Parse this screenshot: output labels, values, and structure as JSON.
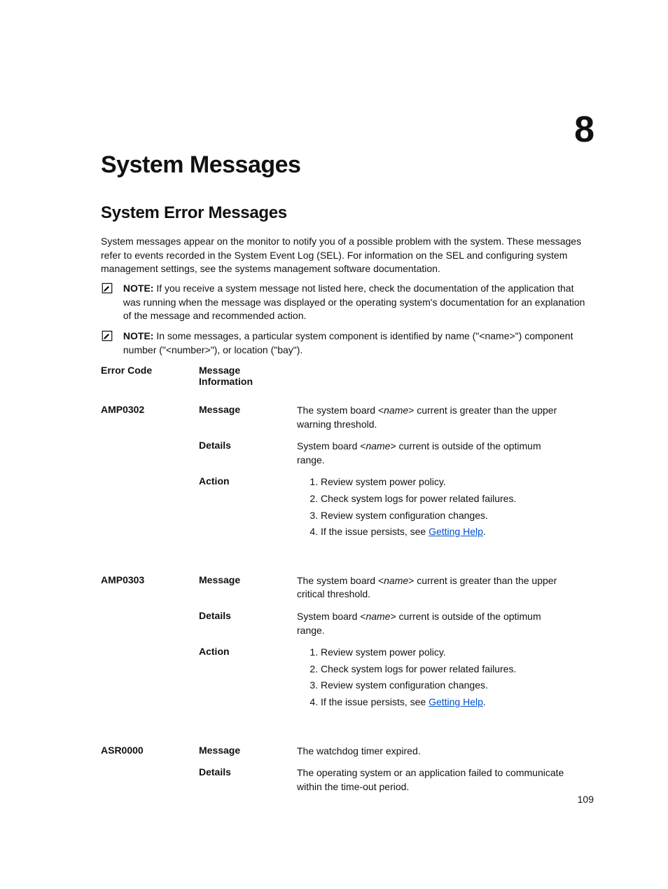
{
  "chapter_number": "8",
  "title": "System Messages",
  "subtitle": "System Error Messages",
  "intro": "System messages appear on the monitor to notify you of a possible problem with the system. These messages refer to events recorded in the System Event Log (SEL). For information on the SEL and configuring system management settings, see the systems management software documentation.",
  "notes": [
    {
      "label": "NOTE:",
      "text": " If you receive a system message not listed here, check the documentation of the application that was running when the message was displayed or the operating system's documentation for an explanation of the message and recommended action."
    },
    {
      "label": "NOTE:",
      "text": " In some messages, a particular system component is identified by name (\"<name>\") component number (\"<number>\"), or location (\"bay\")."
    }
  ],
  "table": {
    "headers": {
      "code": "Error Code",
      "info": "Message Information"
    },
    "labels": {
      "message": "Message",
      "details": "Details",
      "action": "Action"
    },
    "rows": [
      {
        "code": "AMP0302",
        "message_pre": "The system board <",
        "message_italic": "name",
        "message_post": "> current is greater than the upper warning threshold.",
        "details_pre": "System board <",
        "details_italic": "name",
        "details_post": "> current is outside of the optimum range.",
        "actions": [
          "Review system power policy.",
          "Check system logs for power related failures.",
          "Review system configuration changes."
        ],
        "action_last_pre": "If the issue persists, see ",
        "action_last_link": "Getting Help",
        "action_last_post": "."
      },
      {
        "code": "AMP0303",
        "message_pre": "The system board <",
        "message_italic": "name",
        "message_post": "> current is greater than the upper critical threshold.",
        "details_pre": "System board <",
        "details_italic": "name",
        "details_post": "> current is outside of the optimum range.",
        "actions": [
          "Review system power policy.",
          "Check system logs for power related failures.",
          "Review system configuration changes."
        ],
        "action_last_pre": "If the issue persists, see ",
        "action_last_link": "Getting Help",
        "action_last_post": "."
      },
      {
        "code": "ASR0000",
        "message_plain": "The watchdog timer expired.",
        "details_plain": "The operating system or an application failed to communicate within the time-out period."
      }
    ]
  },
  "page_number": "109"
}
